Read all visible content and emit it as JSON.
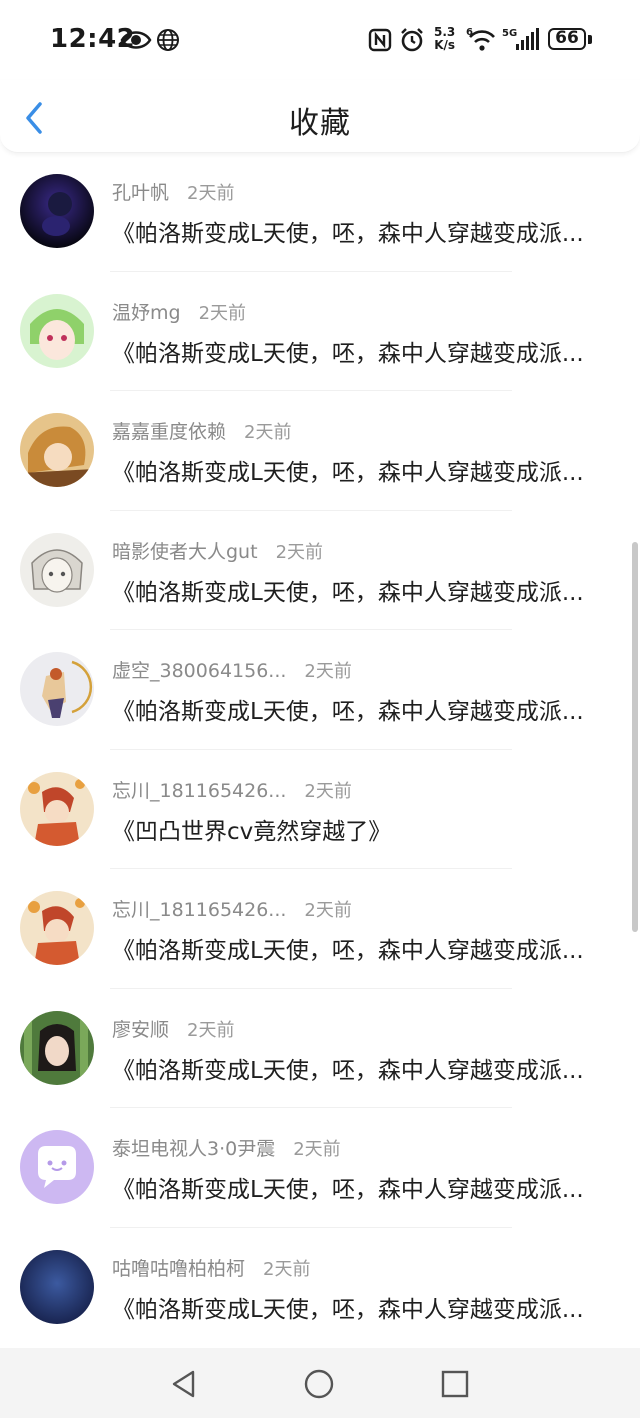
{
  "status_bar": {
    "time": "12:42",
    "speed_value": "5.3",
    "speed_unit": "K/s",
    "battery": "66",
    "icons": [
      "eye-icon",
      "globe-icon",
      "nfc-icon",
      "alarm-icon",
      "wifi-icon",
      "signal-5g-icon",
      "battery-icon"
    ]
  },
  "header": {
    "title": "收藏",
    "back_icon": "chevron-left-icon",
    "accent_color": "#3a8ee6"
  },
  "favorites": [
    {
      "username": "孔叶帆",
      "time": "2天前",
      "content": "《帕洛斯变成L天使，呸，森中人穿越变成派..."
    },
    {
      "username": "温妤mg",
      "time": "2天前",
      "content": "《帕洛斯变成L天使，呸，森中人穿越变成派..."
    },
    {
      "username": "嘉嘉重度依赖",
      "time": "2天前",
      "content": "《帕洛斯变成L天使，呸，森中人穿越变成派..."
    },
    {
      "username": "暗影使者大人gut",
      "time": "2天前",
      "content": "《帕洛斯变成L天使，呸，森中人穿越变成派..."
    },
    {
      "username": "虚空_380064156...",
      "time": "2天前",
      "content": "《帕洛斯变成L天使，呸，森中人穿越变成派..."
    },
    {
      "username": "忘川_181165426...",
      "time": "2天前",
      "content": "《凹凸世界cv竟然穿越了》"
    },
    {
      "username": "忘川_181165426...",
      "time": "2天前",
      "content": "《帕洛斯变成L天使，呸，森中人穿越变成派..."
    },
    {
      "username": "廖安顺",
      "time": "2天前",
      "content": "《帕洛斯变成L天使，呸，森中人穿越变成派..."
    },
    {
      "username": "泰坦电视人3·0尹震",
      "time": "2天前",
      "content": "《帕洛斯变成L天使，呸，森中人穿越变成派..."
    },
    {
      "username": "咕噜咕噜柏柏柯",
      "time": "2天前",
      "content": "《帕洛斯变成L天使，呸，森中人穿越变成派..."
    }
  ],
  "nav": {
    "icons": [
      "back-triangle-icon",
      "home-circle-icon",
      "recents-square-icon"
    ]
  }
}
